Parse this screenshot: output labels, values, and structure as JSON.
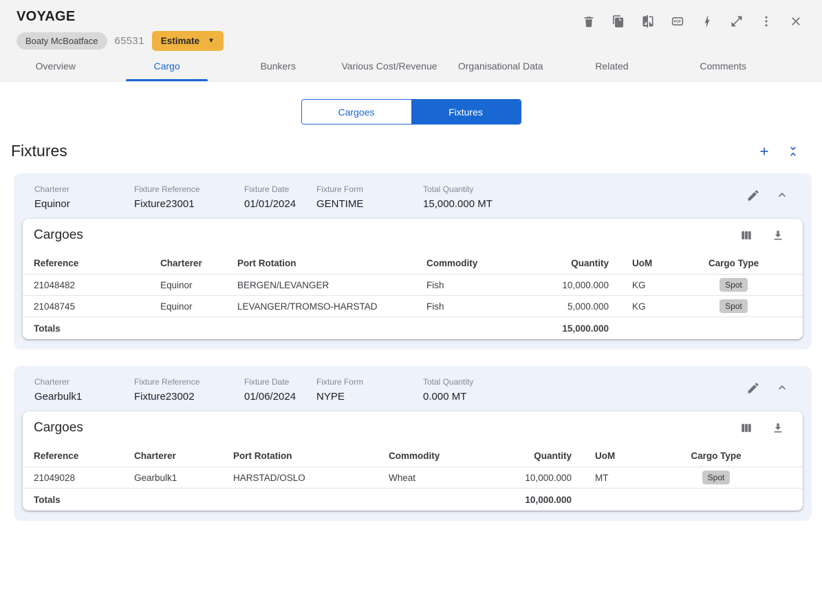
{
  "header": {
    "title": "VOYAGE",
    "vessel_chip": "Boaty McBoatface",
    "voyage_number": "65531",
    "estimate_label": "Estimate",
    "action_icons": [
      "delete-icon",
      "copy-icon",
      "compare-icon",
      "pdf-icon",
      "bolt-icon",
      "expand-icon",
      "more-vert-icon",
      "close-icon"
    ]
  },
  "tabs": [
    {
      "label": "Overview",
      "active": false
    },
    {
      "label": "Cargo",
      "active": true
    },
    {
      "label": "Bunkers",
      "active": false
    },
    {
      "label": "Various Cost/Revenue",
      "active": false
    },
    {
      "label": "Organisational Data",
      "active": false
    },
    {
      "label": "Related",
      "active": false
    },
    {
      "label": "Comments",
      "active": false
    }
  ],
  "view_toggle": {
    "options": [
      {
        "label": "Cargoes",
        "selected": false
      },
      {
        "label": "Fixtures",
        "selected": true
      }
    ]
  },
  "section": {
    "title": "Fixtures",
    "action_icons": [
      "add-icon",
      "collapse-all-icon"
    ]
  },
  "fixtures": [
    {
      "fields": [
        {
          "label": "Charterer",
          "value": "Equinor"
        },
        {
          "label": "Fixture Reference",
          "value": "Fixture23001"
        },
        {
          "label": "Fixture Date",
          "value": "01/01/2024"
        },
        {
          "label": "Fixture Form",
          "value": "GENTIME"
        },
        {
          "label": "Total Quantity",
          "value": "15,000.000 MT"
        }
      ],
      "cargoes": {
        "title": "Cargoes",
        "table_icons": [
          "columns-icon",
          "download-icon"
        ],
        "columns": [
          "Reference",
          "Charterer",
          "Port Rotation",
          "Commodity",
          "Quantity",
          "UoM",
          "Cargo Type"
        ],
        "rows": [
          {
            "reference": "21048482",
            "charterer": "Equinor",
            "port_rotation": "BERGEN/LEVANGER",
            "commodity": "Fish",
            "quantity": "10,000.000",
            "uom": "KG",
            "cargo_type": "Spot"
          },
          {
            "reference": "21048745",
            "charterer": "Equinor",
            "port_rotation": "LEVANGER/TROMSO-HARSTAD",
            "commodity": "Fish",
            "quantity": "5,000.000",
            "uom": "KG",
            "cargo_type": "Spot"
          }
        ],
        "totals": {
          "label": "Totals",
          "quantity": "15,000.000"
        }
      }
    },
    {
      "fields": [
        {
          "label": "Charterer",
          "value": "Gearbulk1"
        },
        {
          "label": "Fixture Reference",
          "value": "Fixture23002"
        },
        {
          "label": "Fixture Date",
          "value": "01/06/2024"
        },
        {
          "label": "Fixture Form",
          "value": "NYPE"
        },
        {
          "label": "Total Quantity",
          "value": "0.000 MT"
        }
      ],
      "cargoes": {
        "title": "Cargoes",
        "table_icons": [
          "columns-icon",
          "download-icon"
        ],
        "columns": [
          "Reference",
          "Charterer",
          "Port Rotation",
          "Commodity",
          "Quantity",
          "UoM",
          "Cargo Type"
        ],
        "rows": [
          {
            "reference": "21049028",
            "charterer": "Gearbulk1",
            "port_rotation": "HARSTAD/OSLO",
            "commodity": "Wheat",
            "quantity": "10,000.000",
            "uom": "MT",
            "cargo_type": "Spot"
          }
        ],
        "totals": {
          "label": "Totals",
          "quantity": "10,000.000"
        }
      }
    }
  ],
  "colors": {
    "accent_blue": "#1967d2",
    "estimate_yellow": "#f1b33f",
    "card_header_bg": "#edf2fb",
    "topbar_bg": "#f3f3f4",
    "badge_gray": "#c9c9c9",
    "icon_gray": "#6f7175"
  }
}
